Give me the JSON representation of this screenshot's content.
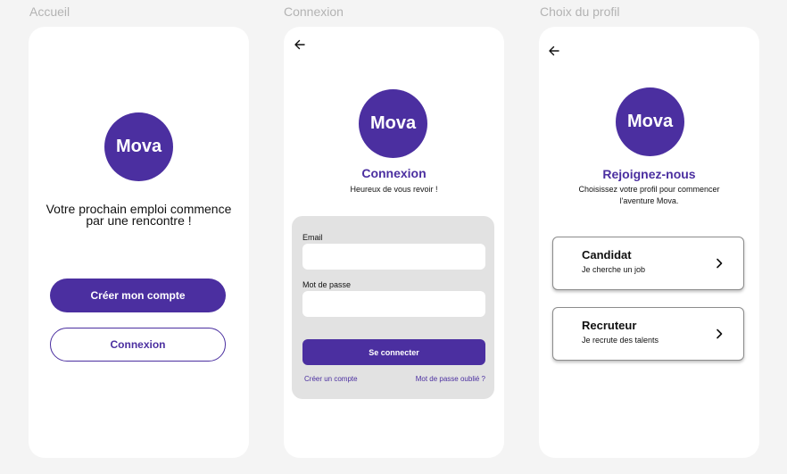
{
  "frames": {
    "accueil": {
      "title": "Accueil",
      "logo": "Mova",
      "tagline_line1": "Votre prochain emploi commence",
      "tagline_line2": "par une rencontre !",
      "create_account": "Créer mon compte",
      "login": "Connexion"
    },
    "connexion": {
      "title": "Connexion",
      "logo": "Mova",
      "heading": "Connexion",
      "subtitle": "Heureux de vous revoir !",
      "email_label": "Email",
      "email_value": "",
      "password_label": "Mot de passe",
      "password_value": "",
      "submit": "Se connecter",
      "create_link": "Créer un compte",
      "forgot_link": "Mot de passe oublié ?"
    },
    "profil": {
      "title": "Choix du profil",
      "logo": "Mova",
      "heading": "Rejoignez-nous",
      "subtitle_line1": "Choisissez votre profil pour commencer",
      "subtitle_line2": "l'aventure Mova.",
      "options": [
        {
          "title": "Candidat",
          "subtitle": "Je cherche un job"
        },
        {
          "title": "Recruteur",
          "subtitle": "Je recrute des talents"
        }
      ]
    }
  },
  "colors": {
    "brand": "#4b2fa0",
    "canvas": "#f4f4f4",
    "card": "#ffffff",
    "form_bg": "#e2e2e2"
  },
  "icons": {
    "back": "arrow-left-icon",
    "chevron": "chevron-right-icon"
  }
}
